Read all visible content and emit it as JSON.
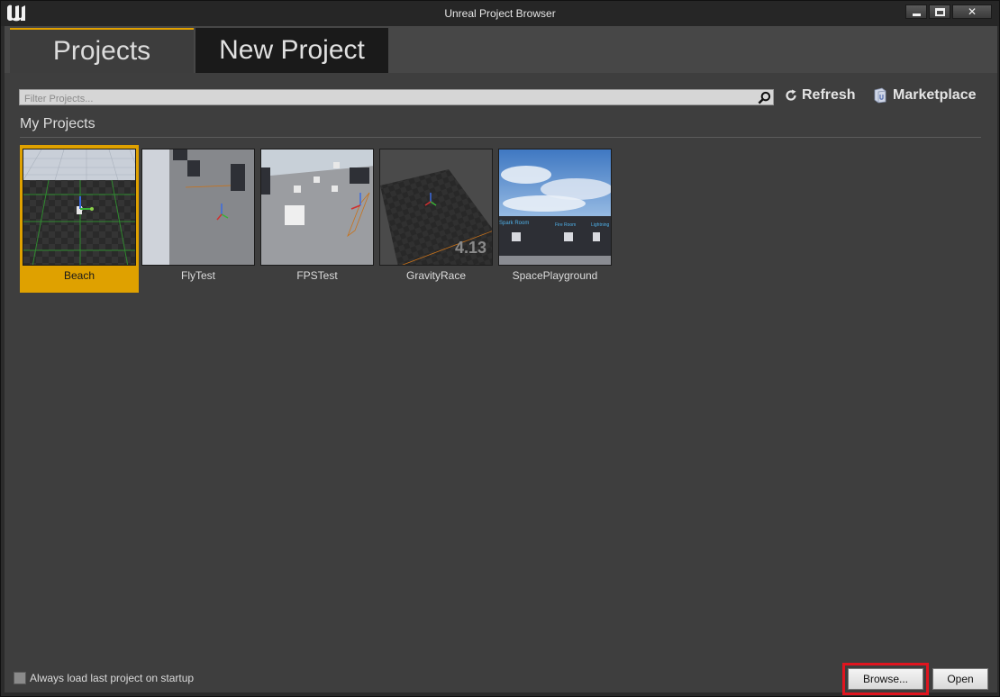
{
  "window": {
    "title": "Unreal Project Browser",
    "close_glyph": "✕"
  },
  "tabs": [
    {
      "label": "Projects",
      "active": true
    },
    {
      "label": "New Project",
      "active": false
    }
  ],
  "filter": {
    "placeholder": "Filter Projects...",
    "value": ""
  },
  "toolbar": {
    "refresh_label": "Refresh",
    "marketplace_label": "Marketplace"
  },
  "section": {
    "title": "My Projects"
  },
  "projects": [
    {
      "name": "Beach",
      "selected": true
    },
    {
      "name": "FlyTest",
      "selected": false
    },
    {
      "name": "FPSTest",
      "selected": false
    },
    {
      "name": "GravityRace",
      "selected": false,
      "version_badge": "4.13"
    },
    {
      "name": "SpacePlayground",
      "selected": false,
      "room_labels": [
        "Spark Room",
        "Fire Room",
        "Lightning"
      ]
    }
  ],
  "footer": {
    "startup_label": "Always load last project on startup",
    "startup_checked": false,
    "browse_label": "Browse...",
    "open_label": "Open"
  },
  "colors": {
    "accent": "#dfa100",
    "highlight_frame": "#e0151f",
    "background": "#3e3e3e"
  },
  "icons": [
    "unreal-logo-icon",
    "minimize-icon",
    "maximize-icon",
    "close-icon",
    "search-icon",
    "refresh-icon",
    "marketplace-icon"
  ]
}
